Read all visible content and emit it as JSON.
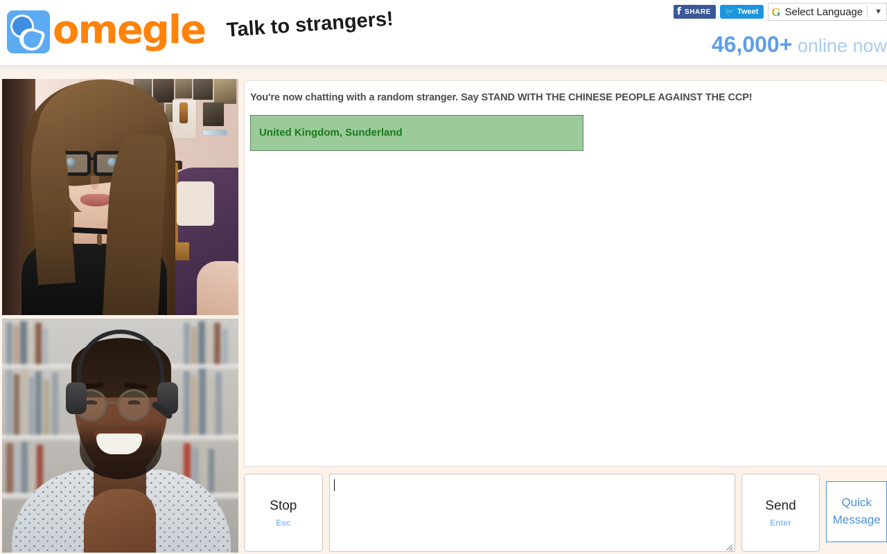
{
  "header": {
    "logo_text": "omegle",
    "logo_icon": "omegle-spy-logo-icon",
    "tagline": "Talk to strangers!",
    "social": {
      "facebook_glyph": "f",
      "facebook_label": "SHARE",
      "twitter_glyph": "🐦",
      "twitter_label": "Tweet"
    },
    "translate": {
      "google_glyph": "G",
      "label": "Select Language",
      "caret": "▼"
    },
    "online": {
      "count": "46,000+",
      "label": " online now",
      "count_color": "#5f9ee8",
      "label_color": "#a9ccf2"
    }
  },
  "video": {
    "self_panel_name": "own-webcam-video",
    "stranger_panel_name": "stranger-webcam-video"
  },
  "chat": {
    "system_message": "You're now chatting with a random stranger. Say STAND WITH THE CHINESE PEOPLE AGAINST THE CCP!",
    "geo_banner": {
      "text": "United Kingdom, Sunderland",
      "background": "#9bca9b",
      "border_color": "#5a8a5a",
      "text_color": "#1a7a1a"
    }
  },
  "controls": {
    "stop": {
      "label": "Stop",
      "shortcut": "Esc"
    },
    "message": {
      "value": "",
      "placeholder": ""
    },
    "send": {
      "label": "Send",
      "shortcut": "Enter"
    },
    "quick_message": {
      "line1": "Quick",
      "line2": "Message",
      "color": "#4a90d9"
    }
  },
  "colors": {
    "page_background": "#fdf3ea",
    "brand_orange": "#ff820a",
    "brand_blue": "#5caaf2"
  }
}
